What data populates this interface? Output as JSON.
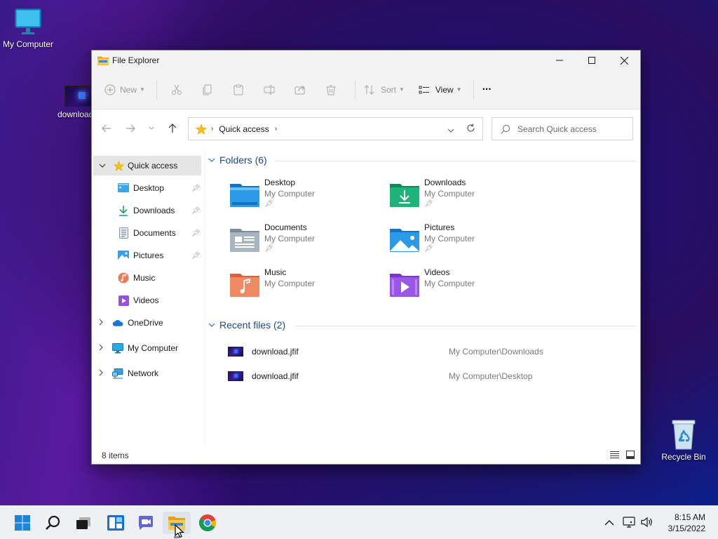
{
  "desktop": {
    "icons": [
      {
        "label": "My Computer"
      },
      {
        "label": "download.jfif"
      },
      {
        "label": "Recycle Bin"
      }
    ]
  },
  "window": {
    "title": "File Explorer",
    "toolbar": {
      "new_label": "New",
      "sort_label": "Sort",
      "view_label": "View",
      "more_label": "···"
    },
    "address": {
      "crumb": "Quick access"
    },
    "search": {
      "placeholder": "Search Quick access"
    },
    "sidebar": {
      "items": [
        {
          "label": "Quick access"
        },
        {
          "label": "Desktop"
        },
        {
          "label": "Downloads"
        },
        {
          "label": "Documents"
        },
        {
          "label": "Pictures"
        },
        {
          "label": "Music"
        },
        {
          "label": "Videos"
        },
        {
          "label": "OneDrive"
        },
        {
          "label": "My Computer"
        },
        {
          "label": "Network"
        }
      ]
    },
    "folders_header": "Folders (6)",
    "folders": [
      {
        "name": "Desktop",
        "location": "My Computer",
        "pinned": true
      },
      {
        "name": "Downloads",
        "location": "My Computer",
        "pinned": true
      },
      {
        "name": "Documents",
        "location": "My Computer",
        "pinned": true
      },
      {
        "name": "Pictures",
        "location": "My Computer",
        "pinned": true
      },
      {
        "name": "Music",
        "location": "My Computer",
        "pinned": false
      },
      {
        "name": "Videos",
        "location": "My Computer",
        "pinned": false
      }
    ],
    "recent_header": "Recent files (2)",
    "recent": [
      {
        "name": "download.jfif",
        "location": "My Computer\\Downloads"
      },
      {
        "name": "download.jfif",
        "location": "My Computer\\Desktop"
      }
    ],
    "status": "8 items"
  },
  "taskbar": {
    "time": "8:15 AM",
    "date": "3/15/2022"
  },
  "colors": {
    "accent": "#1f4a8a",
    "folder_yellow": "#f7c84a",
    "taskbar": "#eef0f4"
  }
}
